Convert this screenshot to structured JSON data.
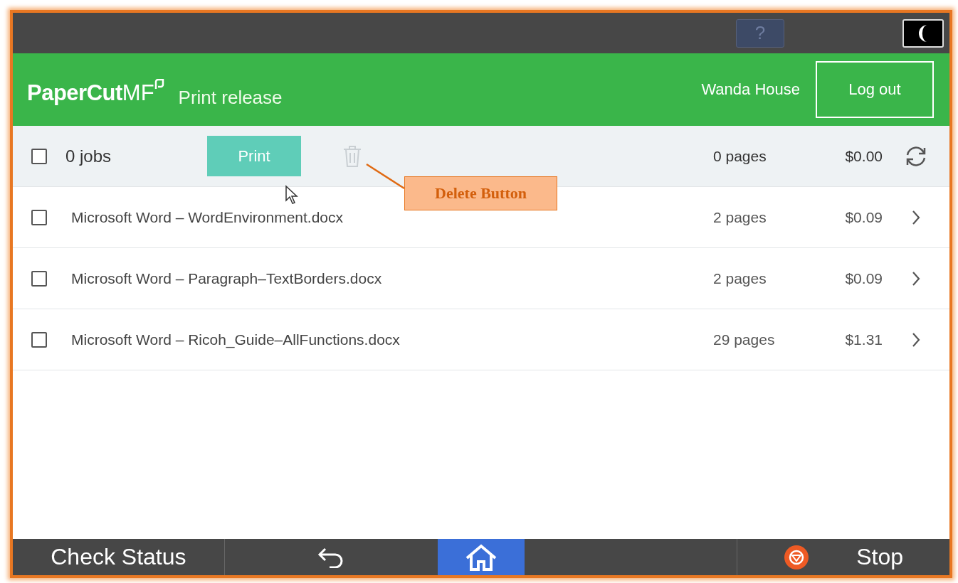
{
  "top_bar": {
    "help_label": "?"
  },
  "header": {
    "logo": {
      "brand": "PaperCut",
      "suffix": "MF"
    },
    "title": "Print release",
    "user": "Wanda House",
    "logout": "Log out"
  },
  "toolbar": {
    "checked": false,
    "count": "0 jobs",
    "print": "Print",
    "delete_disabled": true,
    "pages": "0 pages",
    "cost": "$0.00"
  },
  "jobs": [
    {
      "name": "Microsoft Word – WordEnvironment.docx",
      "pages": "2 pages",
      "cost": "$0.09",
      "checked": false
    },
    {
      "name": "Microsoft Word – Paragraph–TextBorders.docx",
      "pages": "2 pages",
      "cost": "$0.09",
      "checked": false
    },
    {
      "name": "Microsoft Word – Ricoh_Guide–AllFunctions.docx",
      "pages": "29 pages",
      "cost": "$1.31",
      "checked": false
    }
  ],
  "callout": {
    "text": "Delete Button"
  },
  "bottom_bar": {
    "check_status": "Check Status",
    "home_selected": true,
    "stop": "Stop"
  }
}
